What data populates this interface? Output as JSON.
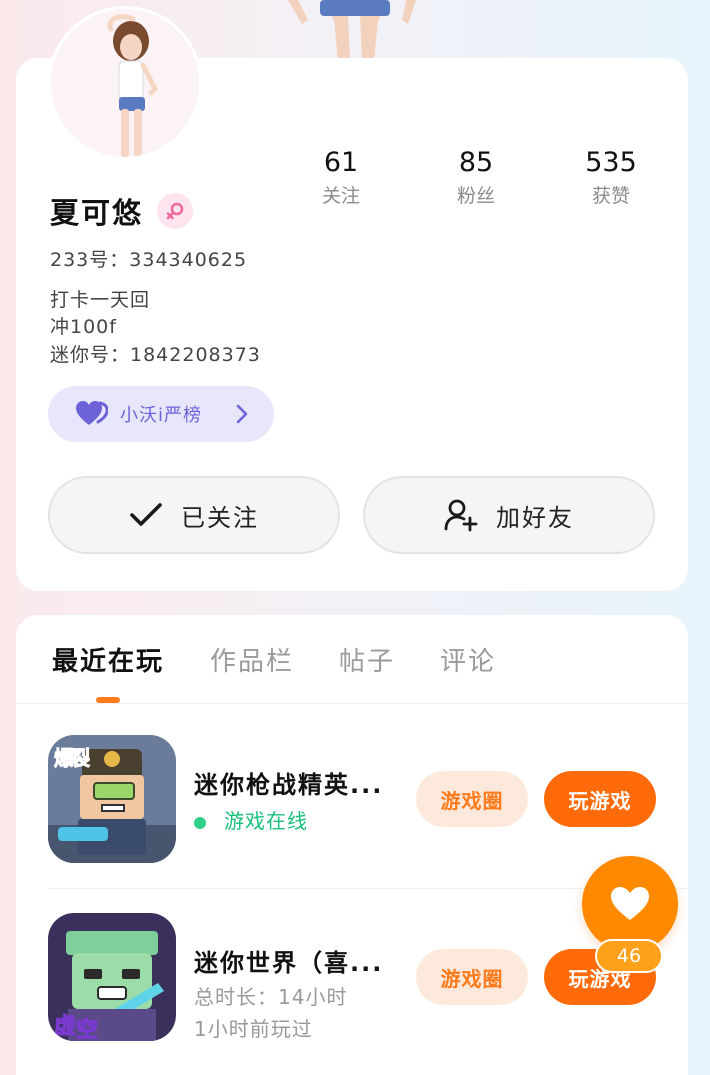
{
  "profile": {
    "name": "夏可悠",
    "gender_icon": "female-symbol-icon",
    "id_line": "233号：334340625",
    "bio_lines": [
      "打卡一天回",
      "冲100f",
      "迷你号：1842208373"
    ],
    "stats": [
      {
        "value": "61",
        "label": "关注"
      },
      {
        "value": "85",
        "label": "粉丝"
      },
      {
        "value": "535",
        "label": "获赞"
      }
    ],
    "tag": {
      "icon": "heart-icon",
      "label": "小沃i严榜"
    },
    "follow_button": "已关注",
    "add_friend_button": "加好友"
  },
  "tabs": [
    "最近在玩",
    "作品栏",
    "帖子",
    "评论"
  ],
  "active_tab": "最近在玩",
  "games": [
    {
      "title": "迷你枪战精英...",
      "status": "游戏在线",
      "circle_button": "游戏圈",
      "play_button": "玩游戏"
    },
    {
      "title": "迷你世界（喜...",
      "total_time": "总时长：14小时",
      "last_played": "1小时前玩过",
      "circle_button": "游戏圈",
      "play_button": "玩游戏"
    }
  ],
  "floating_like": {
    "icon": "heart-icon",
    "count": "46"
  },
  "colors": {
    "accent": "#ff6a0a",
    "online": "#19c07a",
    "tag": "#6c63d9"
  }
}
